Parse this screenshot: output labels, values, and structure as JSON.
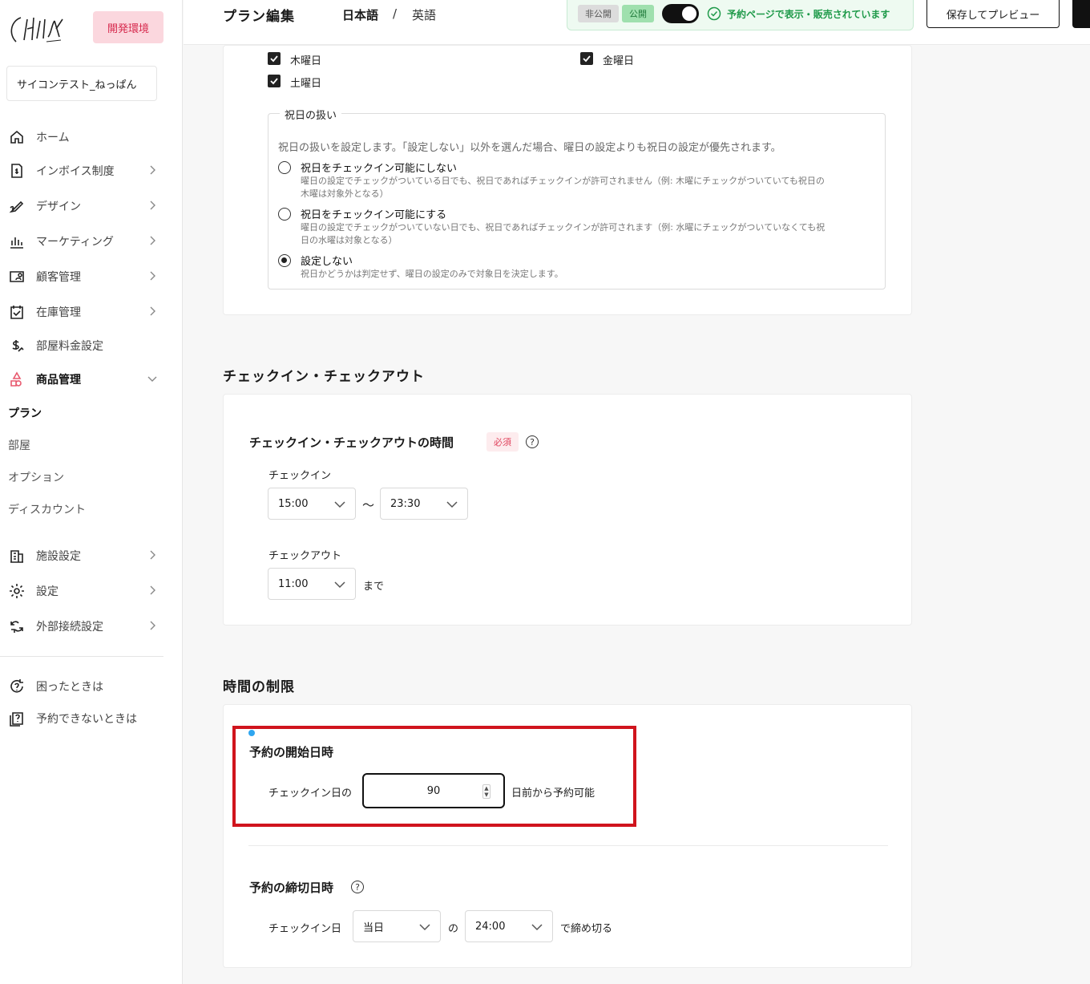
{
  "sidebar": {
    "dev_badge": "開発環境",
    "facility_name": "サイコンテスト_ねっぱん",
    "items": [
      {
        "label": "ホーム",
        "icon": "home-icon"
      },
      {
        "label": "インボイス制度",
        "icon": "invoice-icon"
      },
      {
        "label": "デザイン",
        "icon": "design-icon"
      },
      {
        "label": "マーケティング",
        "icon": "chart-bar-icon"
      },
      {
        "label": "顧客管理",
        "icon": "customer-card-icon"
      },
      {
        "label": "在庫管理",
        "icon": "calendar-check-icon"
      },
      {
        "label": "部屋料金設定",
        "icon": "price-icon"
      },
      {
        "label": "商品管理",
        "icon": "shapes-icon"
      }
    ],
    "sub_items": [
      "プラン",
      "部屋",
      "オプション",
      "ディスカウント"
    ],
    "items2": [
      {
        "label": "施設設定",
        "icon": "building-icon"
      },
      {
        "label": "設定",
        "icon": "gear-icon"
      },
      {
        "label": "外部接続設定",
        "icon": "link-icon"
      }
    ],
    "help_items": [
      {
        "label": "困ったときは",
        "icon": "help-cycle-icon"
      },
      {
        "label": "予約できないときは",
        "icon": "question-doc-icon"
      }
    ]
  },
  "header": {
    "title": "プラン編集",
    "lang_ja": "日本語",
    "lang_sep": "/",
    "lang_en": "英語",
    "pill_private": "非公開",
    "pill_public": "公開",
    "status_text": "予約ページで表示・販売されています",
    "preview_button": "保存してプレビュー"
  },
  "weekdays": {
    "thu": "木曜日",
    "fri": "金曜日",
    "sat": "土曜日"
  },
  "holiday": {
    "legend": "祝日の扱い",
    "hint": "祝日の扱いを設定します。「設定しない」以外を選んだ場合、曜日の設定よりも祝日の設定が優先されます。",
    "options": [
      {
        "label": "祝日をチェックイン可能にしない",
        "desc1": "曜日の設定でチェックがついている日でも、祝日であればチェックインが許可されません（例: 木曜にチェックがついていても祝日の",
        "desc2": "木曜は対象外となる）"
      },
      {
        "label": "祝日をチェックイン可能にする",
        "desc1": "曜日の設定でチェックがついていない日でも、祝日であればチェックインが許可されます（例: 水曜にチェックがついていなくても祝",
        "desc2": "日の水曜は対象となる）"
      },
      {
        "label": "設定しない",
        "desc1": "祝日かどうかは判定せず、曜日の設定のみで対象日を決定します。",
        "desc2": ""
      }
    ]
  },
  "checkin_section": {
    "title": "チェックイン・チェックアウト",
    "field_title": "チェックイン・チェックアウトの時間",
    "required": "必須",
    "checkin_label": "チェックイン",
    "checkin_from": "15:00",
    "tilde": "〜",
    "checkin_to": "23:30",
    "checkout_label": "チェックアウト",
    "checkout_time": "11:00",
    "until": "まで"
  },
  "time_limit": {
    "title": "時間の制限",
    "start_title": "予約の開始日時",
    "start_prefix": "チェックイン日の",
    "start_days": "90",
    "start_suffix": "日前から予約可能",
    "deadline_title": "予約の締切日時",
    "deadline_prefix": "チェックイン日",
    "deadline_day": "当日",
    "deadline_of": "の",
    "deadline_time": "24:00",
    "deadline_suffix": "で締め切る"
  }
}
